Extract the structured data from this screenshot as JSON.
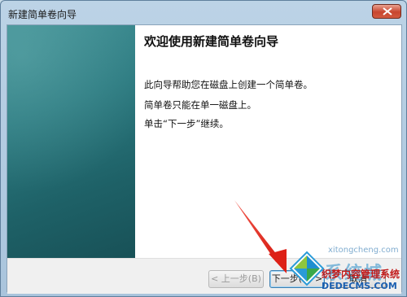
{
  "window": {
    "title": "新建简单卷向导"
  },
  "wizard": {
    "heading": "欢迎使用新建简单卷向导",
    "lines": [
      "此向导帮助您在磁盘上创建一个简单卷。",
      "简单卷只能在单一磁盘上。",
      "单击“下一步”继续。"
    ]
  },
  "buttons": {
    "back": "< 上一步(B)",
    "next": "下一步(N) >",
    "cancel": "取消"
  },
  "watermark": {
    "site_text": "系统城",
    "site_url": "xitongcheng.com",
    "cms_text": "织梦内容管理系统",
    "domain": "DEDECMS.COM"
  },
  "colors": {
    "banner_teal": "#2c7a80",
    "arrow_red": "#e0261b",
    "close_red": "#c8452f"
  }
}
